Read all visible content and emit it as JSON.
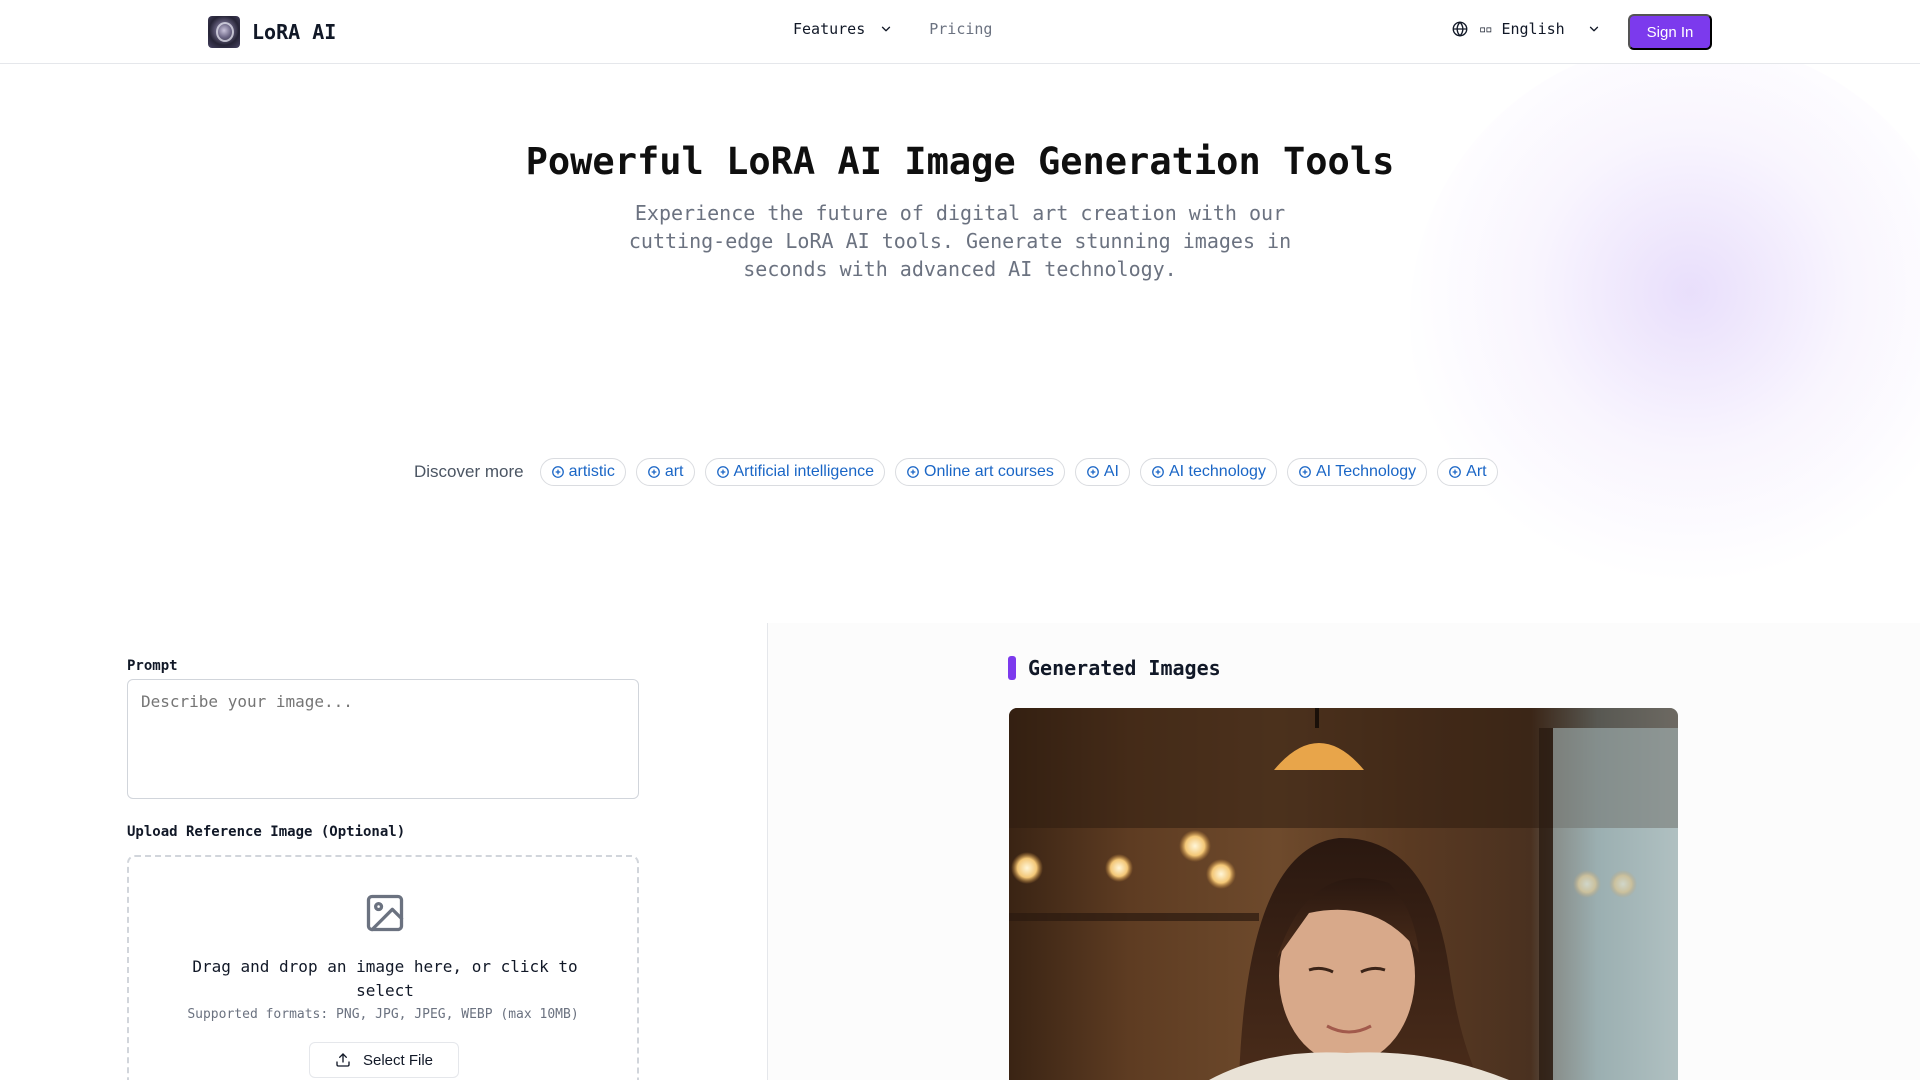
{
  "nav": {
    "brand": "LoRA AI",
    "features_label": "Features",
    "pricing_label": "Pricing",
    "language_flag": "▫▫",
    "language_label": "English",
    "signin_label": "Sign In"
  },
  "hero": {
    "title": "Powerful LoRA AI Image Generation Tools",
    "subtitle": "Experience the future of digital art creation with our cutting-edge LoRA AI tools. Generate stunning images in seconds with advanced AI technology."
  },
  "discover": {
    "label": "Discover more",
    "chips": [
      "artistic",
      "art",
      "Artificial intelligence",
      "Online art courses",
      "AI",
      "AI technology",
      "AI Technology",
      "Art"
    ]
  },
  "form": {
    "prompt_label": "Prompt",
    "prompt_placeholder": "Describe your image...",
    "upload_label": "Upload Reference Image (Optional)",
    "upload_text": "Drag and drop an image here, or click to select",
    "upload_hint": "Supported formats: PNG, JPG, JPEG, WEBP (max 10MB)",
    "select_file_label": "Select File"
  },
  "output": {
    "title": "Generated Images"
  },
  "colors": {
    "accent": "#7c3aed",
    "chip_text": "#1a66c6"
  }
}
